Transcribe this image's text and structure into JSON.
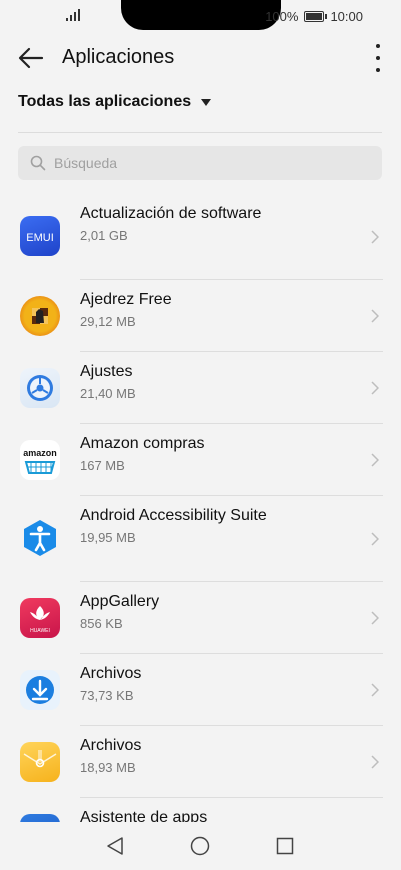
{
  "status": {
    "battery": "100%",
    "time": "10:00"
  },
  "header": {
    "title": "Aplicaciones"
  },
  "filter": {
    "label": "Todas las aplicaciones"
  },
  "search": {
    "placeholder": "Búsqueda"
  },
  "apps": [
    {
      "name": "Actualización de software",
      "size": "2,01 GB",
      "icon": "emui-icon"
    },
    {
      "name": "Ajedrez Free",
      "size": "29,12 MB",
      "icon": "chess-icon"
    },
    {
      "name": "Ajustes",
      "size": "21,40 MB",
      "icon": "settings-icon"
    },
    {
      "name": "Amazon compras",
      "size": "167 MB",
      "icon": "amazon-icon"
    },
    {
      "name": "Android Accessibility Suite",
      "size": "19,95 MB",
      "icon": "accessibility-icon"
    },
    {
      "name": "AppGallery",
      "size": "856 KB",
      "icon": "appgallery-icon"
    },
    {
      "name": "Archivos",
      "size": "73,73 KB",
      "icon": "download-icon"
    },
    {
      "name": "Archivos",
      "size": "18,93 MB",
      "icon": "files-icon"
    },
    {
      "name": "Asistente de apps",
      "size": "",
      "icon": "assistant-icon"
    }
  ],
  "icon_labels": {
    "emui": "EMUI",
    "amazon": "amazon",
    "huawei": "HUAWEI"
  }
}
